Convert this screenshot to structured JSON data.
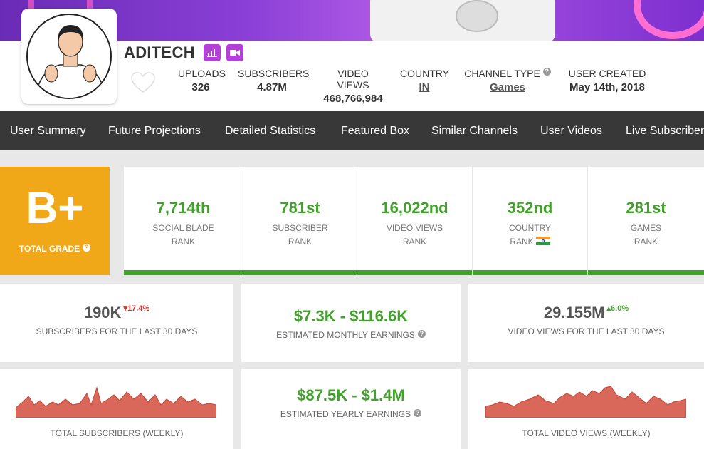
{
  "channel": {
    "name": "ADITECH",
    "stats": [
      {
        "label": "UPLOADS",
        "value": "326"
      },
      {
        "label": "SUBSCRIBERS",
        "value": "4.87M"
      },
      {
        "label": "VIDEO VIEWS",
        "value": "468,766,984"
      },
      {
        "label": "COUNTRY",
        "value": "IN"
      },
      {
        "label": "CHANNEL TYPE",
        "value": "Games"
      },
      {
        "label": "USER CREATED",
        "value": "May 14th, 2018"
      }
    ]
  },
  "nav": [
    "User Summary",
    "Future Projections",
    "Detailed Statistics",
    "Featured Box",
    "Similar Channels",
    "User Videos",
    "Live Subscriber"
  ],
  "grade": {
    "value": "B+",
    "label": "TOTAL GRADE"
  },
  "ranks": [
    {
      "value": "7,714th",
      "line1": "SOCIAL BLADE",
      "line2": "RANK"
    },
    {
      "value": "781st",
      "line1": "SUBSCRIBER",
      "line2": "RANK"
    },
    {
      "value": "16,022nd",
      "line1": "VIDEO VIEWS",
      "line2": "RANK"
    },
    {
      "value": "352nd",
      "line1": "COUNTRY",
      "line2": "RANK"
    },
    {
      "value": "281st",
      "line1": "GAMES",
      "line2": "RANK"
    }
  ],
  "cards": {
    "subs30": {
      "value": "190K",
      "change": "17.4%",
      "caption": "SUBSCRIBERS FOR THE LAST 30 DAYS"
    },
    "monthly": {
      "value": "$7.3K  -  $116.6K",
      "caption": "ESTIMATED MONTHLY EARNINGS"
    },
    "views30": {
      "value": "29.155M",
      "change": "6.0%",
      "caption": "VIDEO VIEWS FOR THE LAST 30 DAYS"
    },
    "total_subs": {
      "caption": "TOTAL SUBSCRIBERS (WEEKLY)"
    },
    "yearly": {
      "value": "$87.5K  -  $1.4M",
      "caption": "ESTIMATED YEARLY EARNINGS"
    },
    "total_views": {
      "caption": "TOTAL VIDEO VIEWS (WEEKLY)"
    }
  },
  "colors": {
    "accent_green": "#41a22a",
    "grade_orange": "#f0a818",
    "nav_bg": "#383838",
    "badge_purple": "#b43fd9",
    "spark_fill": "#d9685a"
  }
}
